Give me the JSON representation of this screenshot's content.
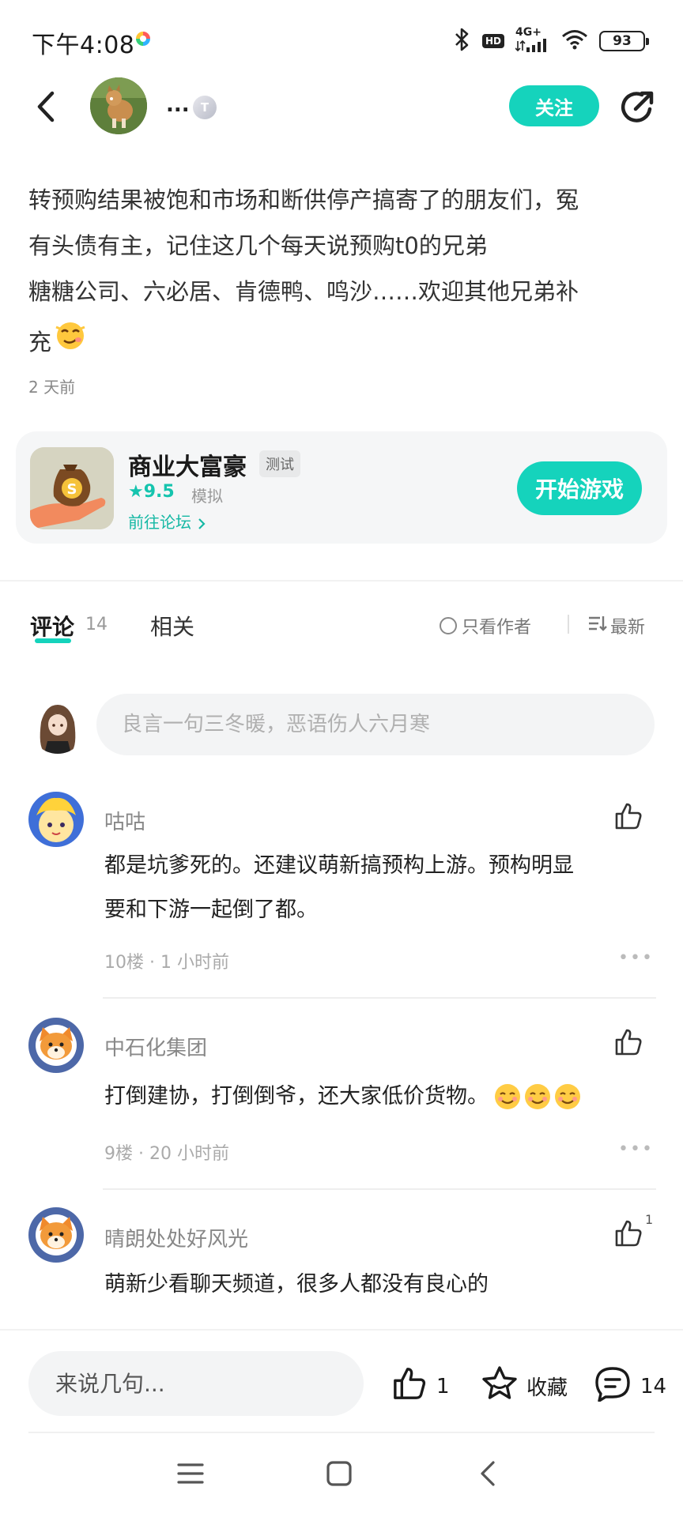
{
  "status_bar": {
    "time": "下午4:08",
    "network": "4G+",
    "hd": "HD",
    "battery": "93"
  },
  "header": {
    "username": "...",
    "level": "T",
    "follow_label": "关注"
  },
  "post": {
    "line1": "转预购结果被饱和市场和断供停产搞寄了的朋友们，冤",
    "line2": "有头债有主，记住这几个每天说预购t0的兄弟",
    "line3": "糖糖公司、六必居、肯德鸭、鸣沙……欢迎其他兄弟补",
    "line4": "充",
    "time": "2 天前"
  },
  "game": {
    "name": "商业大富豪",
    "tag": "测试",
    "rating": "9.5",
    "genre": "模拟",
    "forum_link": "前往论坛",
    "play_label": "开始游戏"
  },
  "tabs": {
    "comments_label": "评论",
    "comments_count": "14",
    "related_label": "相关",
    "author_only": "只看作者",
    "sort": "最新"
  },
  "comment_input": {
    "placeholder": "良言一句三冬暖，恶语伤人六月寒"
  },
  "comments": [
    {
      "name": "咕咕",
      "line1": "都是坑爹死的。还建议萌新搞预构上游。预构明显",
      "line2": "要和下游一起倒了都。",
      "floor": "10楼",
      "time": "1 小时前",
      "likes": ""
    },
    {
      "name": "中石化集团",
      "line1": "打倒建协，打倒倒爷，还大家低价货物。",
      "floor": "9楼",
      "time": "20 小时前",
      "likes": ""
    },
    {
      "name": "晴朗处处好风光",
      "line1": "萌新少看聊天频道，很多人都没有良心的",
      "likes": "1"
    }
  ],
  "bottom_bar": {
    "input_placeholder": "来说几句...",
    "like_count": "1",
    "favorite_label": "收藏",
    "comment_count": "14"
  },
  "colors": {
    "accent": "#15d3bc",
    "text": "#222222",
    "muted": "#888888"
  }
}
